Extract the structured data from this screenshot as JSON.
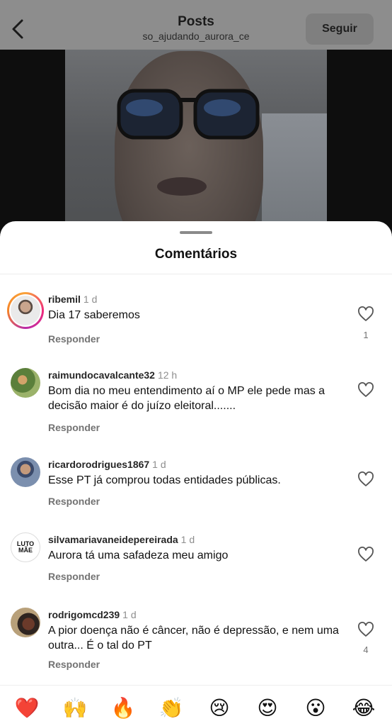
{
  "header": {
    "title": "Posts",
    "subtitle": "so_ajudando_aurora_ce",
    "follow_label": "Seguir"
  },
  "sheet": {
    "title": "Comentários"
  },
  "comments": [
    {
      "username": "ribemil",
      "time": "1 d",
      "text": "Dia 17 saberemos",
      "reply_label": "Responder",
      "likes": "1"
    },
    {
      "username": "raimundocavalcante32",
      "time": "12 h",
      "text": "Bom dia no meu entendimento aí o MP ele pede mas a decisão maior é do juízo eleitoral.......",
      "reply_label": "Responder",
      "likes": ""
    },
    {
      "username": "ricardorodrigues1867",
      "time": "1 d",
      "text": "Esse PT já comprou todas entidades públicas.",
      "reply_label": "Responder",
      "likes": ""
    },
    {
      "username": "silvamariavaneidepereirada",
      "time": "1 d",
      "text": "Aurora tá uma safadeza meu amigo",
      "reply_label": "Responder",
      "likes": "",
      "avatar_text": [
        "LUTO",
        "MÃE"
      ]
    },
    {
      "username": "rodrigomcd239",
      "time": "1 d",
      "text": "A pior doença não é câncer, não é depressão, e nem uma outra... É o tal do PT",
      "reply_label": "Responder",
      "likes": "4"
    }
  ],
  "reactions": [
    "❤️",
    "🙌",
    "🔥",
    "👏",
    "😢",
    "😍",
    "😮",
    "😂"
  ],
  "colors": {
    "overlay_gray": "#8c8c8c",
    "sheet_bg": "#ffffff",
    "muted_text": "#737373",
    "story_ring": "#ee2a7b"
  }
}
